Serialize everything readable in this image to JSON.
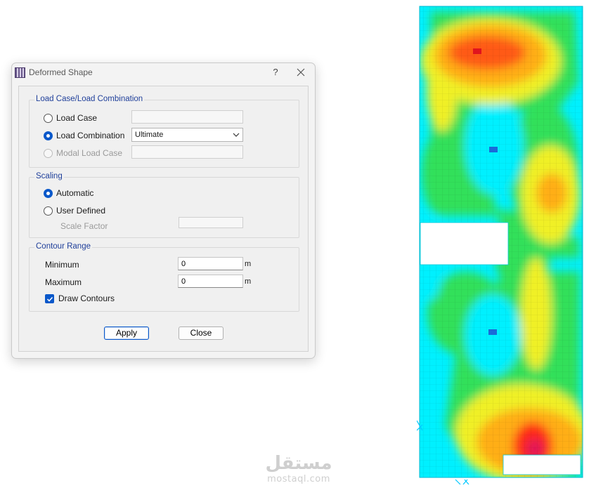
{
  "dialog": {
    "title": "Deformed Shape",
    "help_label": "?",
    "load_group": {
      "title": "Load Case/Load Combination",
      "load_case_label": "Load Case",
      "load_case_value": "",
      "load_combination_label": "Load Combination",
      "load_combination_value": "Ultimate",
      "modal_load_case_label": "Modal Load Case",
      "modal_value": "",
      "selected": "Load Combination"
    },
    "scaling_group": {
      "title": "Scaling",
      "automatic_label": "Automatic",
      "user_defined_label": "User Defined",
      "scale_factor_label": "Scale Factor",
      "scale_factor_value": "",
      "selected": "Automatic"
    },
    "contour_group": {
      "title": "Contour Range",
      "minimum_label": "Minimum",
      "minimum_value": "0",
      "minimum_unit": "m",
      "maximum_label": "Maximum",
      "maximum_value": "0",
      "maximum_unit": "m",
      "draw_contours_label": "Draw Contours",
      "draw_contours_checked": true
    },
    "buttons": {
      "apply": "Apply",
      "close": "Close"
    }
  },
  "watermark": {
    "arabic": "مستقل",
    "latin": "mostaql.com"
  },
  "colors": {
    "accent": "#0a58ca",
    "group_title": "#1f3f9a"
  }
}
